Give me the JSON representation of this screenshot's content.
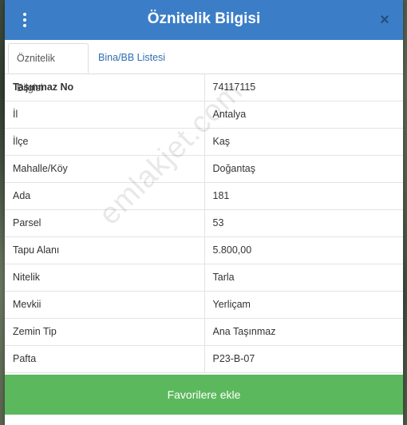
{
  "modal": {
    "title": "Öznitelik Bilgisi",
    "close_glyph": "×"
  },
  "tabs": [
    {
      "label": "Öznitelik Bilgisi",
      "active": true
    },
    {
      "label": "Bina/BB Listesi",
      "active": false
    }
  ],
  "attributes": [
    {
      "key": "Taşınmaz No",
      "value": "74117115"
    },
    {
      "key": "İl",
      "value": "Antalya"
    },
    {
      "key": "İlçe",
      "value": "Kaş"
    },
    {
      "key": "Mahalle/Köy",
      "value": "Doğantaş"
    },
    {
      "key": "Ada",
      "value": "181"
    },
    {
      "key": "Parsel",
      "value": "53"
    },
    {
      "key": "Tapu Alanı",
      "value": "5.800,00"
    },
    {
      "key": "Nitelik",
      "value": "Tarla"
    },
    {
      "key": "Mevkii",
      "value": "Yerliçam"
    },
    {
      "key": "Zemin Tip",
      "value": "Ana Taşınmaz"
    },
    {
      "key": "Pafta",
      "value": "P23-B-07"
    }
  ],
  "watermark": "emlakjet.com",
  "footer": {
    "favorite_label": "Favorilere ekle"
  },
  "colors": {
    "header": "#3b7ec7",
    "favorite_button": "#5cb85c",
    "tab_link": "#2f6fb0"
  },
  "icons": {
    "menu": "kebab-menu-icon",
    "close": "close-icon"
  }
}
